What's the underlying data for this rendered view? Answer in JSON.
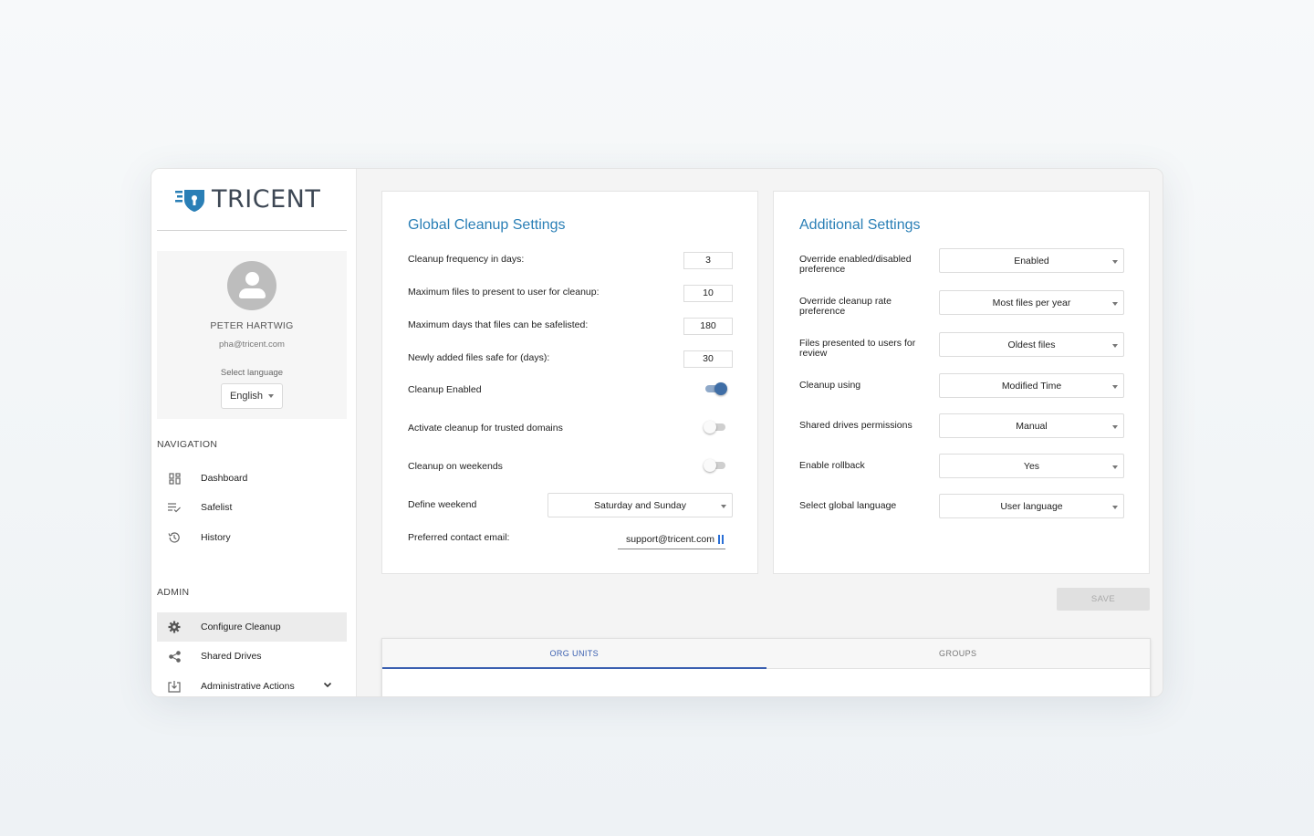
{
  "brand": {
    "name": "TRICENT"
  },
  "profile": {
    "name": "PETER HARTWIG",
    "email": "pha@tricent.com",
    "language_label": "Select language",
    "language_value": "English"
  },
  "navigation": {
    "title": "NAVIGATION",
    "items": [
      {
        "label": "Dashboard",
        "icon": "dashboard-icon"
      },
      {
        "label": "Safelist",
        "icon": "playlist-check-icon"
      },
      {
        "label": "History",
        "icon": "history-icon"
      }
    ]
  },
  "admin": {
    "title": "ADMIN",
    "items": [
      {
        "label": "Configure Cleanup",
        "icon": "gear-icon",
        "active": true
      },
      {
        "label": "Shared Drives",
        "icon": "share-icon"
      },
      {
        "label": "Administrative Actions",
        "icon": "download-box-icon"
      }
    ]
  },
  "global_settings": {
    "title": "Global Cleanup Settings",
    "cleanup_frequency": {
      "label": "Cleanup frequency in days:",
      "value": "3"
    },
    "max_files": {
      "label": "Maximum files to present to user for cleanup:",
      "value": "10"
    },
    "max_days_safelisted": {
      "label": "Maximum days that files can be safelisted:",
      "value": "180"
    },
    "new_files_safe": {
      "label": "Newly added files safe for (days):",
      "value": "30"
    },
    "cleanup_enabled": {
      "label": "Cleanup Enabled",
      "on": true
    },
    "trusted_domains": {
      "label": "Activate cleanup for trusted domains",
      "on": false
    },
    "weekends": {
      "label": "Cleanup on weekends",
      "on": false
    },
    "define_weekend": {
      "label": "Define weekend",
      "value": "Saturday and Sunday"
    },
    "contact_email": {
      "label": "Preferred contact email:",
      "value": "support@tricent.com"
    }
  },
  "additional_settings": {
    "title": "Additional Settings",
    "rows": [
      {
        "label": "Override enabled/disabled preference",
        "value": "Enabled"
      },
      {
        "label": "Override cleanup rate preference",
        "value": "Most files per year"
      },
      {
        "label": "Files presented to users for review",
        "value": "Oldest files"
      },
      {
        "label": "Cleanup using",
        "value": "Modified Time"
      },
      {
        "label": "Shared drives permissions",
        "value": "Manual"
      },
      {
        "label": "Enable rollback",
        "value": "Yes"
      },
      {
        "label": "Select global language",
        "value": "User language"
      }
    ]
  },
  "actions": {
    "save_label": "SAVE"
  },
  "tabs": [
    {
      "label": "ORG UNITS",
      "active": true
    },
    {
      "label": "GROUPS",
      "active": false
    }
  ],
  "colors": {
    "accent": "#2a7fb6",
    "toggle_on": "#3f6ea6",
    "tab_active": "#3a5fb0"
  }
}
